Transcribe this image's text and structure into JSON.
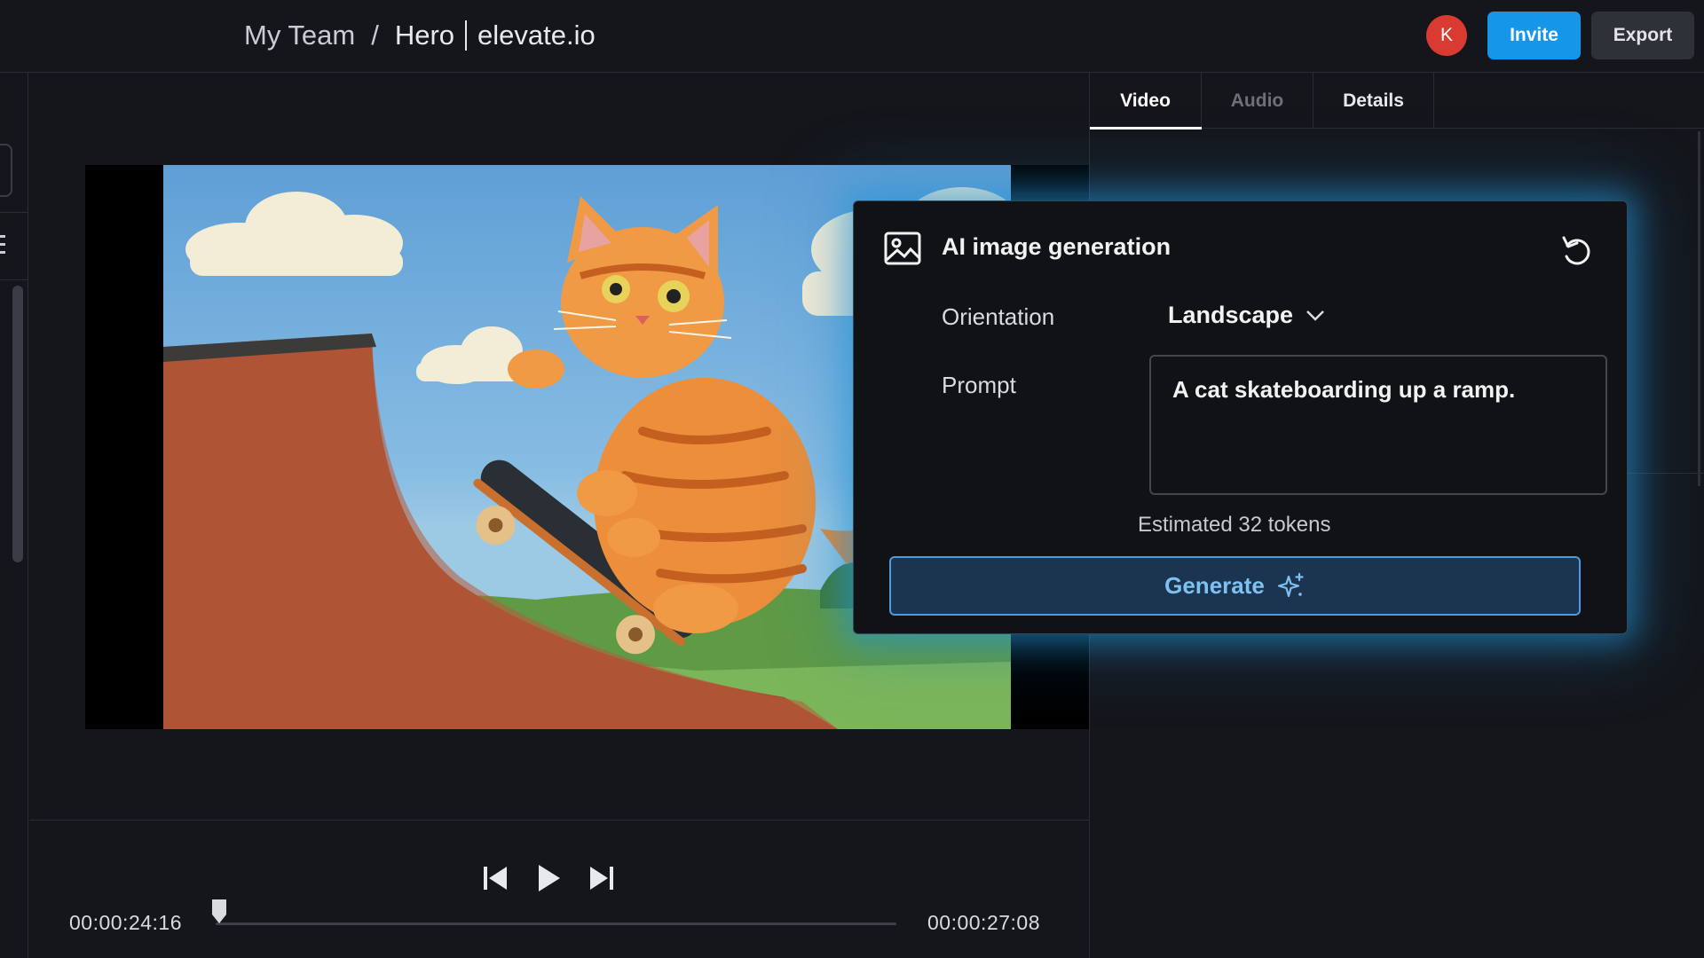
{
  "header": {
    "breadcrumb_team": "My Team",
    "breadcrumb_sep": "/",
    "breadcrumb_project": "Hero",
    "breadcrumb_domain": "elevate.io",
    "avatar_initial": "K",
    "invite_label": "Invite",
    "export_label": "Export"
  },
  "player": {
    "current_time": "00:00:24:16",
    "total_time": "00:00:27:08",
    "progress_fraction": 0.0
  },
  "tabs": [
    {
      "label": "Video",
      "state": "active"
    },
    {
      "label": "Audio",
      "state": "disabled"
    },
    {
      "label": "Details",
      "state": "normal"
    }
  ],
  "ai_panel": {
    "title": "AI image generation",
    "orientation_label": "Orientation",
    "orientation_value": "Landscape",
    "prompt_label": "Prompt",
    "prompt_value": "A cat skateboarding up a ramp.",
    "token_estimate": "Estimated 32 tokens",
    "generate_label": "Generate"
  },
  "colors": {
    "accent": "#1596e9",
    "avatar": "#d93a32",
    "generate_bg": "#1b3550",
    "generate_border": "#4b9de0",
    "glow": "#2396d7"
  },
  "icons": [
    "image-icon",
    "reset-icon",
    "chevron-down-icon",
    "sparkle-icon",
    "skip-back-icon",
    "play-icon",
    "skip-forward-icon"
  ]
}
